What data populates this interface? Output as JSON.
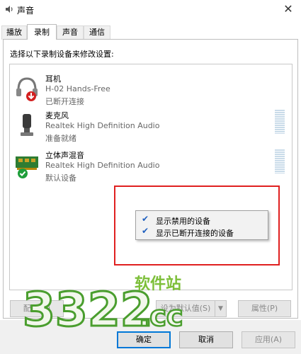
{
  "window": {
    "title": "声音",
    "close_glyph": "✕"
  },
  "tabs": [
    {
      "label": "播放",
      "active": false
    },
    {
      "label": "录制",
      "active": true
    },
    {
      "label": "声音",
      "active": false
    },
    {
      "label": "通信",
      "active": false
    }
  ],
  "instruction": "选择以下录制设备来修改设置:",
  "devices": [
    {
      "name": "耳机",
      "description": "H-02 Hands-Free",
      "status": "已断开连接",
      "icon": "headset-icon"
    },
    {
      "name": "麦克风",
      "description": "Realtek High Definition Audio",
      "status": "准备就绪",
      "icon": "microphone-icon"
    },
    {
      "name": "立体声混音",
      "description": "Realtek High Definition Audio",
      "status": "默认设备",
      "icon": "sound-card-icon"
    }
  ],
  "context_menu": [
    {
      "label": "显示禁用的设备",
      "checked": true
    },
    {
      "label": "显示已断开连接的设备",
      "checked": true
    }
  ],
  "pane_buttons": {
    "configure": "配置(C)",
    "set_default": "设为默认值(S)",
    "properties": "属性(P)"
  },
  "dialog_buttons": {
    "ok": "确定",
    "cancel": "取消",
    "apply": "应用(A)"
  },
  "watermark": {
    "number": "3322",
    "suffix": ".cc",
    "text": "软件站"
  },
  "colors": {
    "accent": "#0078d7",
    "highlight_box": "#e02020",
    "check": "#1f5fbf"
  }
}
